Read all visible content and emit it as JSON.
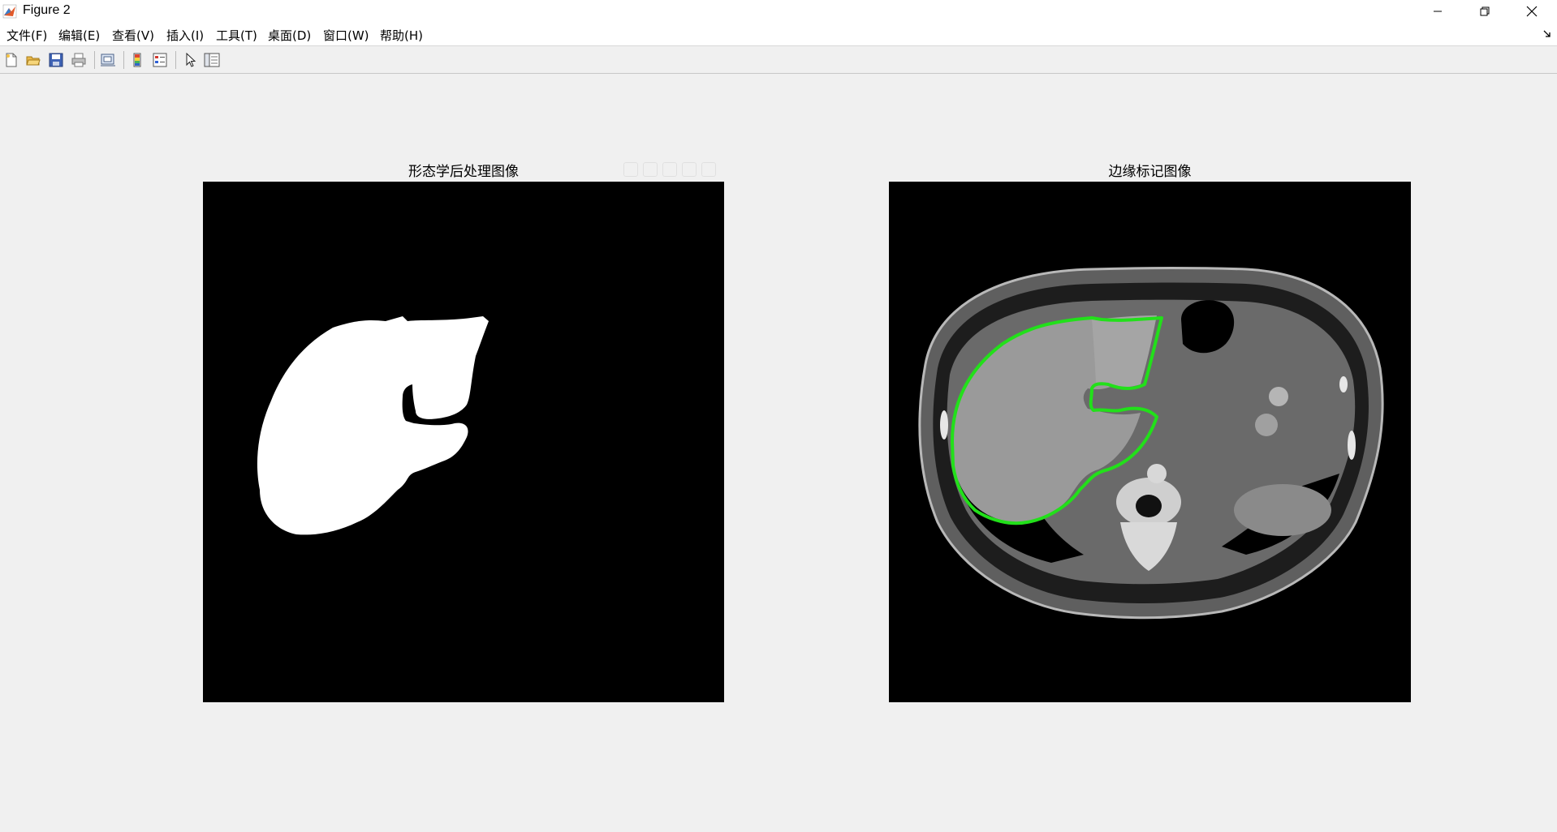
{
  "window": {
    "title": "Figure 2"
  },
  "menu": {
    "items": [
      "文件(F)",
      "编辑(E)",
      "查看(V)",
      "插入(I)",
      "工具(T)",
      "桌面(D)",
      "窗口(W)",
      "帮助(H)"
    ]
  },
  "toolbar": {
    "icons": [
      "new-figure-icon",
      "open-file-icon",
      "save-icon",
      "print-icon",
      "link-plot-icon",
      "colorbar-icon",
      "legend-icon",
      "pointer-icon",
      "property-inspector-icon"
    ]
  },
  "axes": [
    {
      "title": "形态学后处理图像",
      "content": "binary liver mask (white on black)"
    },
    {
      "title": "边缘标记图像",
      "content": "CT slice with green liver contour"
    }
  ],
  "colors": {
    "mask": "#ffffff",
    "background": "#000000",
    "contour": "#22e01a",
    "figure_bg": "#f0f0f0"
  }
}
